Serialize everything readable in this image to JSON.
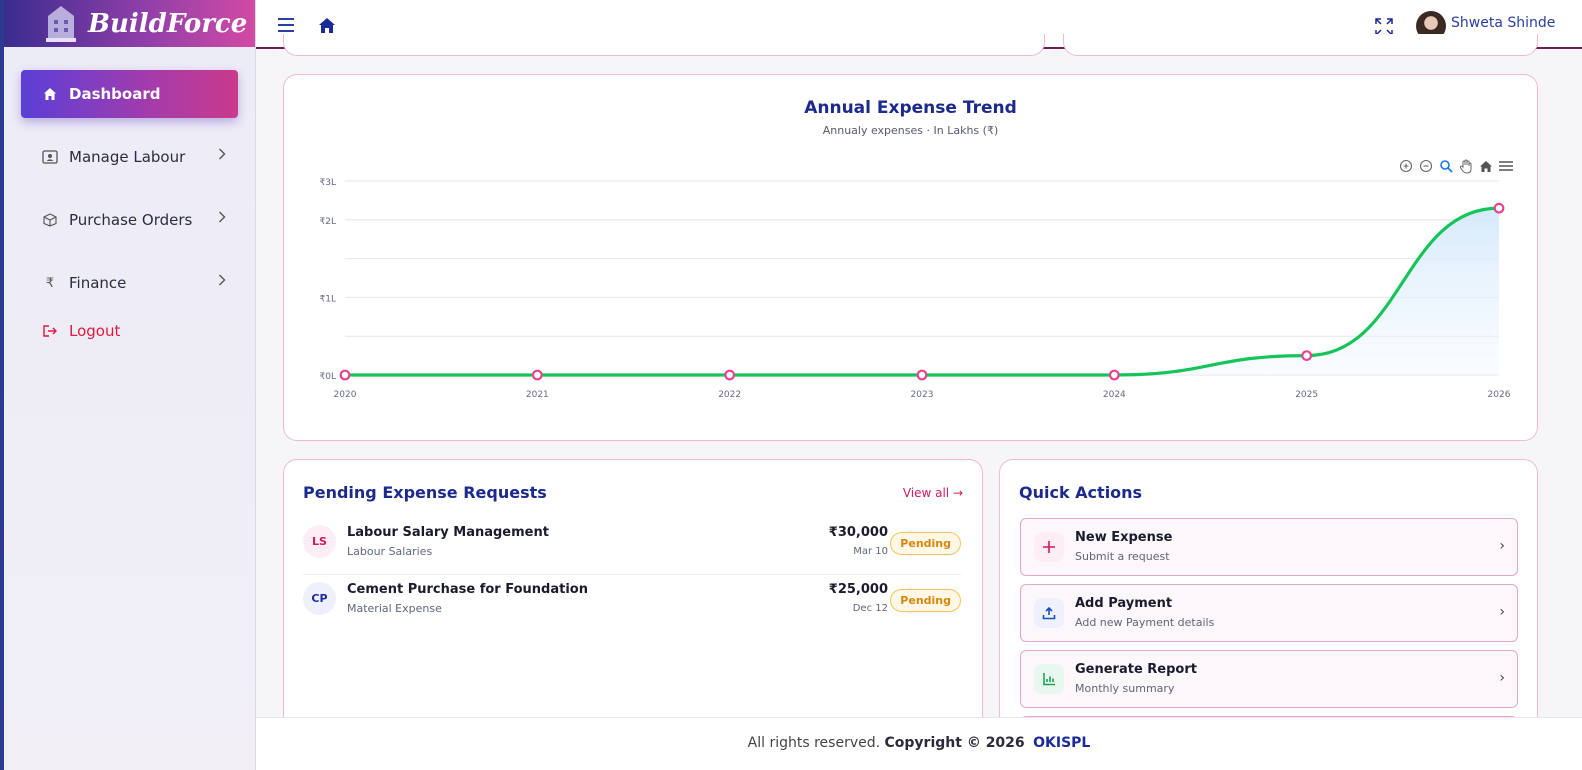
{
  "brand": {
    "name": "BuildForce"
  },
  "sidebar": {
    "items": [
      {
        "label": "Dashboard",
        "icon": "home-icon",
        "active": true
      },
      {
        "label": "Manage Labour",
        "icon": "id-card-icon"
      },
      {
        "label": "Purchase Orders",
        "icon": "box-icon"
      },
      {
        "label": "Finance",
        "icon": "rupee-icon"
      },
      {
        "label": "Logout",
        "icon": "logout-icon"
      }
    ]
  },
  "header": {
    "user_name": "Shweta Shinde"
  },
  "chart": {
    "title": "Annual Expense Trend",
    "subtitle": "Annualy expenses · In Lakhs (₹)"
  },
  "chart_data": {
    "type": "area",
    "title": "Annual Expense Trend",
    "subtitle": "Annualy expenses · In Lakhs (₹)",
    "x": [
      "2020",
      "2021",
      "2022",
      "2023",
      "2024",
      "2025",
      "2026"
    ],
    "series": [
      {
        "values": [
          0,
          0,
          0,
          0,
          0,
          0.5,
          4.3
        ]
      }
    ],
    "yticks": [
      "₹0L",
      "₹1L",
      "₹2L",
      "₹3L"
    ],
    "ylim": [
      0,
      5
    ],
    "grid": true,
    "line_color": "#16c45a",
    "marker_color": "#e5458f"
  },
  "pending": {
    "title": "Pending Expense Requests",
    "view_all": "View all →",
    "items": [
      {
        "initials": "LS",
        "title": "Labour Salary Management",
        "category": "Labour Salaries",
        "amount": "₹30,000",
        "date": "Mar 10",
        "status": "Pending"
      },
      {
        "initials": "CP",
        "title": "Cement Purchase for Foundation",
        "category": "Material Expense",
        "amount": "₹25,000",
        "date": "Dec 12",
        "status": "Pending"
      }
    ]
  },
  "quick_actions": {
    "title": "Quick Actions",
    "items": [
      {
        "title": "New Expense",
        "sub": "Submit a request",
        "icon": "plus-icon"
      },
      {
        "title": "Add Payment",
        "sub": "Add new Payment details",
        "icon": "upload-icon"
      },
      {
        "title": "Generate Report",
        "sub": "Monthly summary",
        "icon": "bar-chart-icon"
      }
    ],
    "chevron": "›"
  },
  "footer": {
    "prefix": "All rights reserved.",
    "copyright": "Copyright © 2026",
    "org": "OKISPL"
  }
}
